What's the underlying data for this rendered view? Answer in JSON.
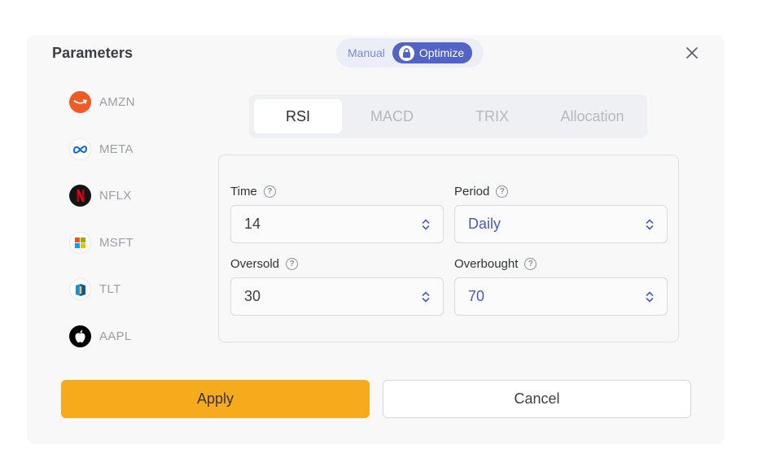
{
  "dialog": {
    "title": "Parameters",
    "mode": {
      "manual_label": "Manual",
      "optimize_label": "Optimize",
      "selected": "Optimize"
    }
  },
  "tickers": [
    {
      "label": "AMZN",
      "icon": "amazon-logo-icon",
      "color": "#f15a24"
    },
    {
      "label": "META",
      "icon": "meta-logo-icon",
      "color": "#0a66e4"
    },
    {
      "label": "NFLX",
      "icon": "netflix-logo-icon",
      "color": "#e50914"
    },
    {
      "label": "MSFT",
      "icon": "microsoft-logo-icon",
      "color": "#f25022"
    },
    {
      "label": "TLT",
      "icon": "tlt-logo-icon",
      "color": "#1a8fd8"
    },
    {
      "label": "AAPL",
      "icon": "apple-logo-icon",
      "color": "#000000"
    }
  ],
  "tabs": [
    {
      "label": "RSI",
      "active": true
    },
    {
      "label": "MACD",
      "active": false
    },
    {
      "label": "TRIX",
      "active": false
    },
    {
      "label": "Allocation",
      "active": false
    }
  ],
  "fields": {
    "time": {
      "label": "Time",
      "value": "14"
    },
    "period": {
      "label": "Period",
      "value": "Daily"
    },
    "oversold": {
      "label": "Oversold",
      "value": "30"
    },
    "overbought": {
      "label": "Overbought",
      "value": "70"
    },
    "help_glyph": "?"
  },
  "actions": {
    "apply_label": "Apply",
    "cancel_label": "Cancel"
  },
  "colors": {
    "accent": "#5262c6",
    "apply": "#f6ab1d"
  }
}
